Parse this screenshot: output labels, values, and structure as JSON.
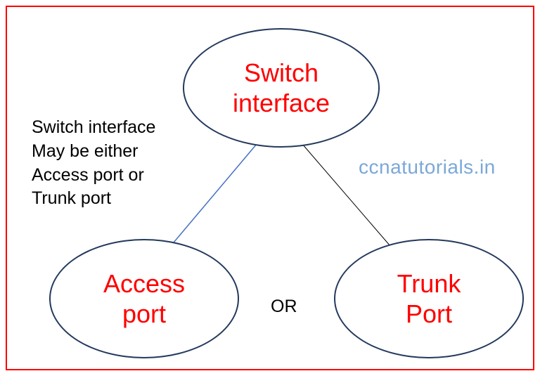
{
  "nodes": {
    "top": {
      "line1": "Switch",
      "line2": "interface"
    },
    "left": {
      "line1": "Access",
      "line2": "port"
    },
    "right": {
      "line1": "Trunk",
      "line2": "Port"
    }
  },
  "description": {
    "line1": "Switch interface",
    "line2": "May be either",
    "line3": "Access port or",
    "line4": "Trunk port"
  },
  "or_label": "OR",
  "watermark": "ccnatutorials.in"
}
